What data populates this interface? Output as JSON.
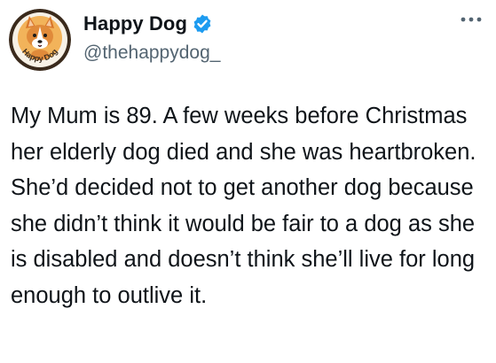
{
  "tweet": {
    "display_name": "Happy Dog",
    "handle": "@thehappydog_",
    "avatar_text": "Happy Dog",
    "text": "My Mum is 89. A few weeks before Christmas her elderly dog died and she was heartbroken. She’d decided not to get another dog because she didn’t think it would be fair to a dog as she is disabled and doesn’t think she’ll live for long enough to outlive it.",
    "icons": {
      "verified": "verified-badge-icon",
      "more": "more-options-icon",
      "avatar": "corgi-logo"
    },
    "colors": {
      "verified": "#1d9bf0",
      "avatar_ring": "#3a2a1c",
      "avatar_bg": "#f2b35a",
      "text": "#0f1419",
      "secondary": "#536471"
    }
  }
}
